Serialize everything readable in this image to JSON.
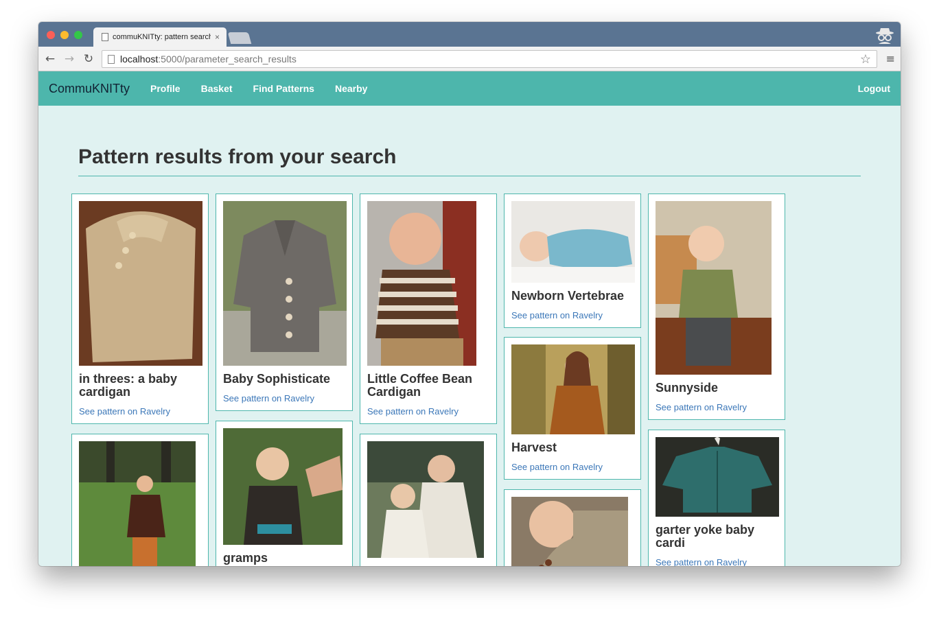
{
  "browser": {
    "tab_title": "commuKNITty: pattern search results",
    "tab_close": "×",
    "url_host": "localhost",
    "url_path": ":5000/parameter_search_results"
  },
  "nav": {
    "brand": "CommuKNITty",
    "links": [
      "Profile",
      "Basket",
      "Find Patterns",
      "Nearby"
    ],
    "logout": "Logout"
  },
  "page": {
    "heading": "Pattern results from your search"
  },
  "link_label": "See pattern on Ravelry",
  "cards": [
    {
      "title": "in threes: a baby cardigan"
    },
    {
      "title": "Baby Sophisticate"
    },
    {
      "title": "Little Coffee Bean Cardigan"
    },
    {
      "title": "Newborn Vertebrae"
    },
    {
      "title": "Sunnyside"
    },
    {
      "title": ""
    },
    {
      "title": "gramps"
    },
    {
      "title": ""
    },
    {
      "title": "Harvest"
    },
    {
      "title": ""
    },
    {
      "title": "garter yoke baby cardi"
    }
  ],
  "colors": {
    "navbar": "#4db6ac",
    "page_bg": "#e0f2f1",
    "link": "#3b77b8"
  }
}
